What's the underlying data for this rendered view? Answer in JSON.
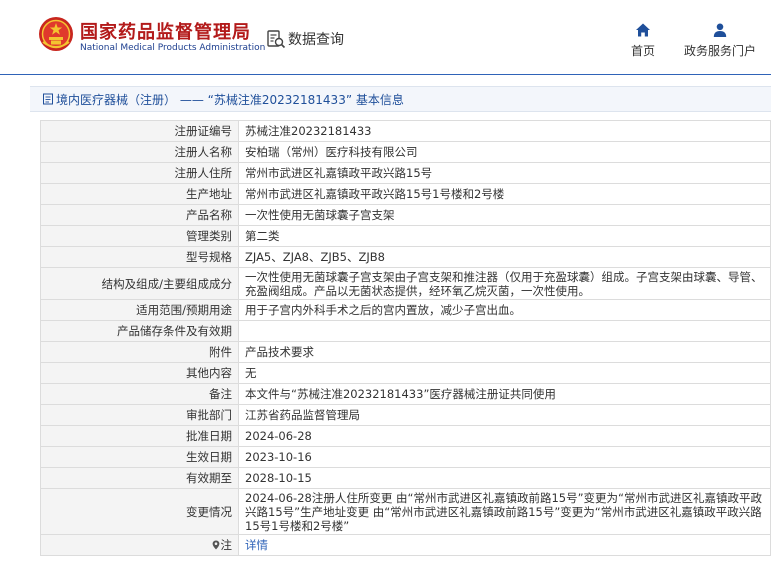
{
  "header": {
    "brand_cn": "国家药品监督管理局",
    "brand_en": "National Medical Products Administration",
    "db_query_label": "数据查询",
    "nav": {
      "home_label": "首页",
      "portal_label": "政务服务门户"
    }
  },
  "breadcrumb": {
    "text": "境内医疗器械（注册） —— “苏械注准20232181433” 基本信息"
  },
  "colors": {
    "brand_red": "#b31a1a",
    "brand_blue": "#1e3f8f",
    "link_blue": "#2f63b8",
    "label_bg": "#f4f4f4"
  },
  "records": [
    {
      "label": "注册证编号",
      "value": "苏械注准20232181433"
    },
    {
      "label": "注册人名称",
      "value": "安柏瑞（常州）医疗科技有限公司"
    },
    {
      "label": "注册人住所",
      "value": "常州市武进区礼嘉镇政平政兴路15号"
    },
    {
      "label": "生产地址",
      "value": "常州市武进区礼嘉镇政平政兴路15号1号楼和2号楼"
    },
    {
      "label": "产品名称",
      "value": "一次性使用无菌球囊子宫支架"
    },
    {
      "label": "管理类别",
      "value": "第二类"
    },
    {
      "label": "型号规格",
      "value": "ZJA5、ZJA8、ZJB5、ZJB8"
    },
    {
      "label": "结构及组成/主要组成成分",
      "value": "一次性使用无菌球囊子宫支架由子宫支架和推注器（仅用于充盈球囊）组成。子宫支架由球囊、导管、充盈阀组成。产品以无菌状态提供，经环氧乙烷灭菌，一次性使用。"
    },
    {
      "label": "适用范围/预期用途",
      "value": "用于子宫内外科手术之后的宫内置放，减少子宫出血。"
    },
    {
      "label": "产品储存条件及有效期",
      "value": ""
    },
    {
      "label": "附件",
      "value": "产品技术要求"
    },
    {
      "label": "其他内容",
      "value": "无"
    },
    {
      "label": "备注",
      "value": "本文件与“苏械注准20232181433”医疗器械注册证共同使用"
    },
    {
      "label": "审批部门",
      "value": "江苏省药品监督管理局"
    },
    {
      "label": "批准日期",
      "value": "2024-06-28"
    },
    {
      "label": "生效日期",
      "value": "2023-10-16"
    },
    {
      "label": "有效期至",
      "value": "2028-10-15"
    },
    {
      "label": "变更情况",
      "value": "2024-06-28注册人住所变更 由“常州市武进区礼嘉镇政前路15号”变更为“常州市武进区礼嘉镇政平政兴路15号”生产地址变更 由“常州市武进区礼嘉镇政前路15号”变更为“常州市武进区礼嘉镇政平政兴路15号1号楼和2号楼”"
    },
    {
      "label": "注",
      "value": "详情"
    }
  ]
}
